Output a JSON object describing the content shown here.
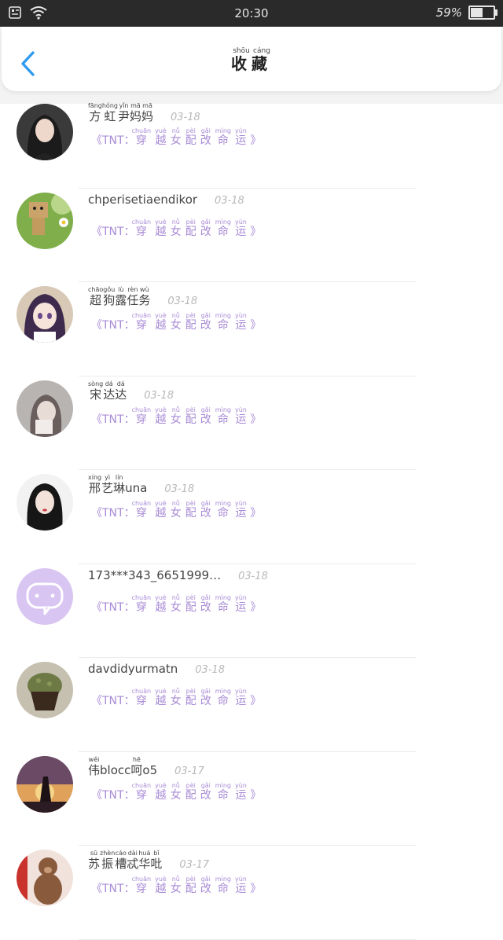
{
  "status_bar": {
    "time": "20:30",
    "battery_text": "59%",
    "battery_level": 0.59
  },
  "header": {
    "title_chars": [
      {
        "char": "收",
        "pinyin": "shōu"
      },
      {
        "char": "藏",
        "pinyin": "cáng"
      }
    ]
  },
  "book_title": {
    "prefix": "《TNT：",
    "chars": [
      {
        "char": "穿",
        "pinyin": "chuān"
      },
      {
        "char": "越",
        "pinyin": "yuè"
      },
      {
        "char": "女",
        "pinyin": "nǚ"
      },
      {
        "char": "配",
        "pinyin": "pèi"
      },
      {
        "char": "改",
        "pinyin": "gǎi"
      },
      {
        "char": "命",
        "pinyin": "mìng"
      },
      {
        "char": "运",
        "pinyin": "yùn"
      }
    ],
    "suffix": "》"
  },
  "items": [
    {
      "name_parts": [
        {
          "char": "方",
          "pinyin": "fāng"
        },
        {
          "char": "虹",
          "pinyin": "hóng"
        },
        {
          "char": "尹",
          "pinyin": "yǐn"
        },
        {
          "char": "妈",
          "pinyin": "mā"
        },
        {
          "char": "妈",
          "pinyin": "mā"
        }
      ],
      "date": "03-18",
      "avatar": "portrait-dark-hair"
    },
    {
      "name_parts": [
        {
          "char": "chperisetiaendikor",
          "pinyin": ""
        }
      ],
      "date": "03-18",
      "avatar": "cardboard-robot-flower"
    },
    {
      "name_parts": [
        {
          "char": "超",
          "pinyin": "chāo"
        },
        {
          "char": "狗",
          "pinyin": "gǒu"
        },
        {
          "char": "露",
          "pinyin": "lù"
        },
        {
          "char": "任",
          "pinyin": "rèn"
        },
        {
          "char": "务",
          "pinyin": "wù"
        }
      ],
      "date": "03-18",
      "avatar": "anime-girl"
    },
    {
      "name_parts": [
        {
          "char": "宋",
          "pinyin": "sòng"
        },
        {
          "char": "达",
          "pinyin": "dá"
        },
        {
          "char": "达",
          "pinyin": "dá"
        }
      ],
      "date": "03-18",
      "avatar": "portrait-grey"
    },
    {
      "name_parts": [
        {
          "char": "邢",
          "pinyin": "xíng"
        },
        {
          "char": "艺",
          "pinyin": "yì"
        },
        {
          "char": "琳",
          "pinyin": "lín"
        },
        {
          "char": "una",
          "pinyin": ""
        }
      ],
      "date": "03-18",
      "avatar": "portrait-black-hair"
    },
    {
      "name_parts": [
        {
          "char": "173***343_6651999…",
          "pinyin": ""
        }
      ],
      "date": "03-18",
      "avatar": "default-chat-bubble"
    },
    {
      "name_parts": [
        {
          "char": "davdidyurmatn",
          "pinyin": ""
        }
      ],
      "date": "03-18",
      "avatar": "cupcake"
    },
    {
      "name_parts": [
        {
          "char": "伟",
          "pinyin": "wěi"
        },
        {
          "char": "blocc",
          "pinyin": ""
        },
        {
          "char": "呵",
          "pinyin": "hē"
        },
        {
          "char": "o5",
          "pinyin": ""
        }
      ],
      "date": "03-17",
      "avatar": "sunset-silhouette"
    },
    {
      "name_parts": [
        {
          "char": "苏",
          "pinyin": "sū"
        },
        {
          "char": "振",
          "pinyin": "zhèn"
        },
        {
          "char": "槽",
          "pinyin": "cáo"
        },
        {
          "char": "忒",
          "pinyin": "dài"
        },
        {
          "char": "华",
          "pinyin": "huá"
        },
        {
          "char": "吡",
          "pinyin": "bǐ"
        }
      ],
      "date": "03-17",
      "avatar": "teddy-bear"
    }
  ],
  "colors": {
    "accent_blue": "#2f9cf0",
    "book_purple": "#a88bd6",
    "chat_avatar_bg": "#d9c5f2"
  }
}
